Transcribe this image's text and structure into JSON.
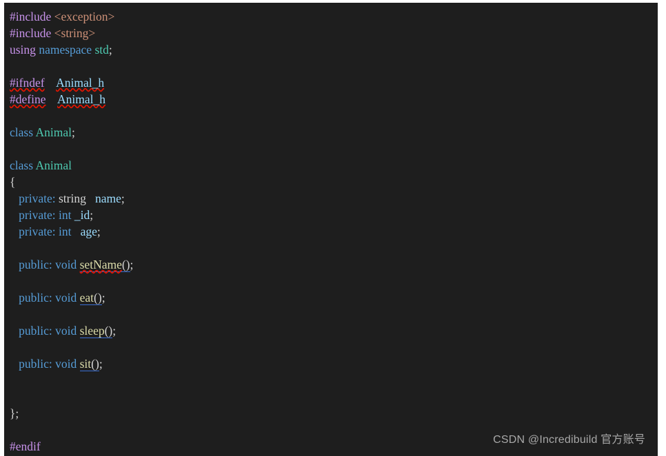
{
  "editor": {
    "background_color": "#1e1e1e",
    "language": "cpp",
    "font_size_px": 17,
    "line_height_px": 24
  },
  "theme": {
    "background": "#1e1e1e",
    "default_text": "#d4d4d4",
    "preprocessor": "#c792ea",
    "include_header": "#ce9178",
    "keyword": "#569cd6",
    "type_name": "#4ec9b0",
    "variable": "#9cdcfe",
    "function_name": "#dcdcaa",
    "error_squiggle": "#e51400",
    "reference_underline": "#3b6fd4"
  },
  "code": {
    "lines": [
      {
        "n": 1,
        "indent": "",
        "tokens": [
          {
            "text": "#include",
            "kind": "preprocessor"
          },
          {
            "text": " ",
            "kind": "plain"
          },
          {
            "text": "<exception>",
            "kind": "include_header"
          }
        ]
      },
      {
        "n": 2,
        "indent": "",
        "tokens": [
          {
            "text": "#include",
            "kind": "preprocessor"
          },
          {
            "text": " ",
            "kind": "plain"
          },
          {
            "text": "<string>",
            "kind": "include_header"
          }
        ]
      },
      {
        "n": 3,
        "indent": "",
        "tokens": [
          {
            "text": "using",
            "kind": "preprocessor"
          },
          {
            "text": " ",
            "kind": "plain"
          },
          {
            "text": "namespace",
            "kind": "keyword"
          },
          {
            "text": " ",
            "kind": "plain"
          },
          {
            "text": "std",
            "kind": "type_name"
          },
          {
            "text": ";",
            "kind": "plain"
          }
        ]
      },
      {
        "n": 4,
        "indent": "",
        "tokens": []
      },
      {
        "n": 5,
        "indent": "",
        "tokens": [
          {
            "text": "#ifndef",
            "kind": "preprocessor",
            "squiggle": true
          },
          {
            "text": "    ",
            "kind": "plain"
          },
          {
            "text": "Animal_h",
            "kind": "variable",
            "squiggle": true
          }
        ]
      },
      {
        "n": 6,
        "indent": "",
        "tokens": [
          {
            "text": "#define",
            "kind": "preprocessor",
            "squiggle": true
          },
          {
            "text": "    ",
            "kind": "plain"
          },
          {
            "text": "Animal_h",
            "kind": "variable",
            "squiggle": true
          }
        ]
      },
      {
        "n": 7,
        "indent": "",
        "tokens": []
      },
      {
        "n": 8,
        "indent": "",
        "tokens": [
          {
            "text": "class",
            "kind": "keyword"
          },
          {
            "text": " ",
            "kind": "plain"
          },
          {
            "text": "Animal",
            "kind": "type_name"
          },
          {
            "text": ";",
            "kind": "plain"
          }
        ]
      },
      {
        "n": 9,
        "indent": "",
        "tokens": []
      },
      {
        "n": 10,
        "indent": "",
        "tokens": [
          {
            "text": "class",
            "kind": "keyword"
          },
          {
            "text": " ",
            "kind": "plain"
          },
          {
            "text": "Animal",
            "kind": "type_name"
          }
        ]
      },
      {
        "n": 11,
        "indent": "",
        "tokens": [
          {
            "text": "{",
            "kind": "plain"
          }
        ]
      },
      {
        "n": 12,
        "indent": "   ",
        "tokens": [
          {
            "text": "private",
            "kind": "keyword"
          },
          {
            "text": ":",
            "kind": "keyword"
          },
          {
            "text": " ",
            "kind": "plain"
          },
          {
            "text": "string",
            "kind": "plain"
          },
          {
            "text": "   ",
            "kind": "plain"
          },
          {
            "text": "name",
            "kind": "variable"
          },
          {
            "text": ";",
            "kind": "plain"
          }
        ]
      },
      {
        "n": 13,
        "indent": "   ",
        "tokens": [
          {
            "text": "private",
            "kind": "keyword"
          },
          {
            "text": ":",
            "kind": "keyword"
          },
          {
            "text": " ",
            "kind": "plain"
          },
          {
            "text": "int",
            "kind": "keyword"
          },
          {
            "text": " ",
            "kind": "plain"
          },
          {
            "text": "_id",
            "kind": "variable"
          },
          {
            "text": ";",
            "kind": "plain"
          }
        ]
      },
      {
        "n": 14,
        "indent": "   ",
        "tokens": [
          {
            "text": "private",
            "kind": "keyword"
          },
          {
            "text": ":",
            "kind": "keyword"
          },
          {
            "text": " ",
            "kind": "plain"
          },
          {
            "text": "int",
            "kind": "keyword"
          },
          {
            "text": "   ",
            "kind": "plain"
          },
          {
            "text": "age",
            "kind": "variable"
          },
          {
            "text": ";",
            "kind": "plain"
          }
        ]
      },
      {
        "n": 15,
        "indent": "",
        "tokens": []
      },
      {
        "n": 16,
        "indent": "   ",
        "tokens": [
          {
            "text": "public",
            "kind": "keyword"
          },
          {
            "text": ":",
            "kind": "keyword"
          },
          {
            "text": " ",
            "kind": "plain"
          },
          {
            "text": "void",
            "kind": "keyword"
          },
          {
            "text": " ",
            "kind": "plain"
          },
          {
            "text": "setName",
            "kind": "function_name",
            "squiggle": true,
            "underline": true
          },
          {
            "text": "()",
            "kind": "plain",
            "underline": true
          },
          {
            "text": ";",
            "kind": "plain"
          }
        ]
      },
      {
        "n": 17,
        "indent": "",
        "tokens": []
      },
      {
        "n": 18,
        "indent": "   ",
        "tokens": [
          {
            "text": "public",
            "kind": "keyword"
          },
          {
            "text": ":",
            "kind": "keyword"
          },
          {
            "text": " ",
            "kind": "plain"
          },
          {
            "text": "void",
            "kind": "keyword"
          },
          {
            "text": " ",
            "kind": "plain"
          },
          {
            "text": "eat",
            "kind": "function_name",
            "underline": true
          },
          {
            "text": "()",
            "kind": "plain",
            "underline": true
          },
          {
            "text": ";",
            "kind": "plain"
          }
        ]
      },
      {
        "n": 19,
        "indent": "",
        "tokens": []
      },
      {
        "n": 20,
        "indent": "   ",
        "tokens": [
          {
            "text": "public",
            "kind": "keyword"
          },
          {
            "text": ":",
            "kind": "keyword"
          },
          {
            "text": " ",
            "kind": "plain"
          },
          {
            "text": "void",
            "kind": "keyword"
          },
          {
            "text": " ",
            "kind": "plain"
          },
          {
            "text": "sleep",
            "kind": "function_name",
            "underline": true
          },
          {
            "text": "()",
            "kind": "plain",
            "underline": true
          },
          {
            "text": ";",
            "kind": "plain"
          }
        ]
      },
      {
        "n": 21,
        "indent": "",
        "tokens": []
      },
      {
        "n": 22,
        "indent": "   ",
        "tokens": [
          {
            "text": "public",
            "kind": "keyword"
          },
          {
            "text": ":",
            "kind": "keyword"
          },
          {
            "text": " ",
            "kind": "plain"
          },
          {
            "text": "void",
            "kind": "keyword"
          },
          {
            "text": " ",
            "kind": "plain"
          },
          {
            "text": "sit",
            "kind": "function_name",
            "underline": true
          },
          {
            "text": "()",
            "kind": "plain",
            "underline": true
          },
          {
            "text": ";",
            "kind": "plain"
          }
        ]
      },
      {
        "n": 23,
        "indent": "",
        "tokens": []
      },
      {
        "n": 24,
        "indent": "",
        "tokens": []
      },
      {
        "n": 25,
        "indent": "",
        "tokens": [
          {
            "text": "};",
            "kind": "plain"
          }
        ]
      },
      {
        "n": 26,
        "indent": "",
        "tokens": []
      },
      {
        "n": 27,
        "indent": "",
        "tokens": [
          {
            "text": "#endif",
            "kind": "preprocessor"
          }
        ]
      }
    ]
  },
  "watermark": {
    "text": "CSDN @Incredibuild 官方账号"
  }
}
